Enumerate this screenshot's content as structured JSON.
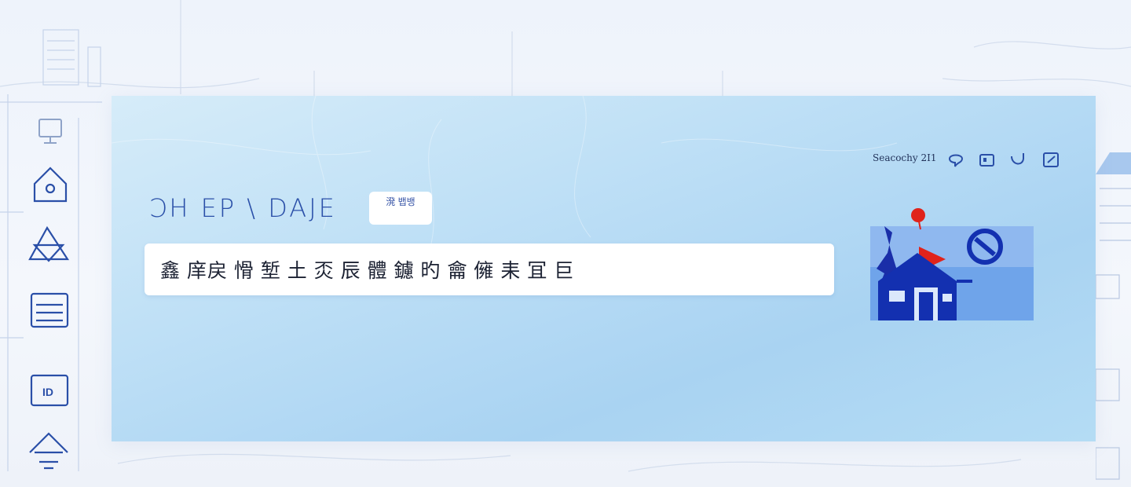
{
  "header": {
    "label": "Seacochy 2I1",
    "icons": [
      "chat-icon",
      "window-icon",
      "hook-icon",
      "edit-icon"
    ]
  },
  "brand": {
    "title": "ƆH EP \\ DAJE",
    "badge": "溌 뱁뱅"
  },
  "search": {
    "text": "鑫 庠戻 愲 堑  土 㶪 辰 體 鑢 旳 龠 㒕 耒 冝 巨"
  },
  "rail": {
    "icons": [
      "monitor-icon",
      "home-icon",
      "triangle-icon",
      "document-icon",
      "id-card-icon",
      "house-icon"
    ]
  },
  "colors": {
    "accent": "#2a4fa8",
    "panel": "#bfe0f6",
    "illustration_red": "#e0231b"
  }
}
